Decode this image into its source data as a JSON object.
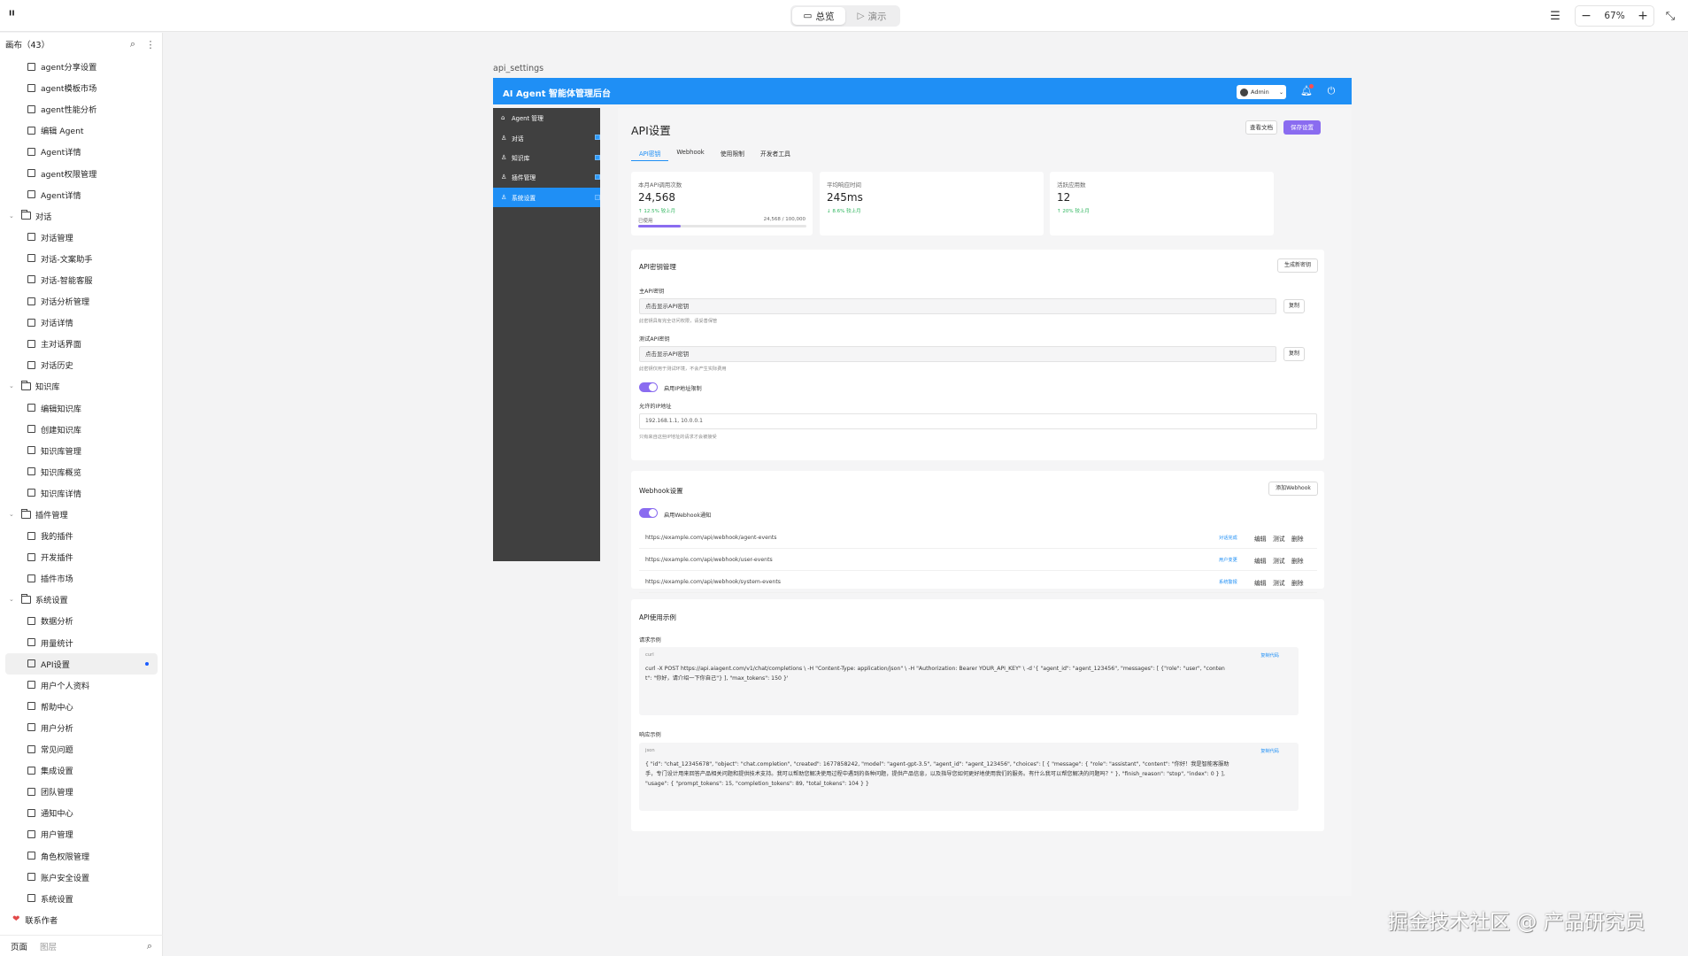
{
  "toolbar": {
    "logo": "ᐦ",
    "overview_label": "总览",
    "present_label": "演示",
    "zoom": "67%",
    "zoom_out": "−",
    "zoom_in": "+"
  },
  "layers_panel": {
    "title": "画布（43）",
    "tree": [
      {
        "type": "page",
        "label": "agent分享设置"
      },
      {
        "type": "page",
        "label": "agent模板市场"
      },
      {
        "type": "page",
        "label": "agent性能分析"
      },
      {
        "type": "page",
        "label": "编辑 Agent"
      },
      {
        "type": "page",
        "label": "Agent详情"
      },
      {
        "type": "page",
        "label": "agent权限管理"
      },
      {
        "type": "page",
        "label": "Agent详情"
      },
      {
        "type": "group",
        "label": "对话"
      },
      {
        "type": "page",
        "label": "对话管理"
      },
      {
        "type": "page",
        "label": "对话-文案助手"
      },
      {
        "type": "page",
        "label": "对话-智能客服"
      },
      {
        "type": "page",
        "label": "对话分析管理"
      },
      {
        "type": "page",
        "label": "对话详情"
      },
      {
        "type": "page",
        "label": "主对话界面"
      },
      {
        "type": "page",
        "label": "对话历史"
      },
      {
        "type": "group",
        "label": "知识库"
      },
      {
        "type": "page",
        "label": "编辑知识库"
      },
      {
        "type": "page",
        "label": "创建知识库"
      },
      {
        "type": "page",
        "label": "知识库管理"
      },
      {
        "type": "page",
        "label": "知识库概览"
      },
      {
        "type": "page",
        "label": "知识库详情"
      },
      {
        "type": "group",
        "label": "插件管理"
      },
      {
        "type": "page",
        "label": "我的插件"
      },
      {
        "type": "page",
        "label": "开发插件"
      },
      {
        "type": "page",
        "label": "插件市场"
      },
      {
        "type": "group",
        "label": "系统设置"
      },
      {
        "type": "page",
        "label": "数据分析"
      },
      {
        "type": "page",
        "label": "用量统计"
      },
      {
        "type": "page",
        "label": "API设置",
        "selected": true
      },
      {
        "type": "page",
        "label": "用户个人资料"
      },
      {
        "type": "page",
        "label": "帮助中心"
      },
      {
        "type": "page",
        "label": "用户分析"
      },
      {
        "type": "page",
        "label": "常见问题"
      },
      {
        "type": "page",
        "label": "集成设置"
      },
      {
        "type": "page",
        "label": "团队管理"
      },
      {
        "type": "page",
        "label": "通知中心"
      },
      {
        "type": "page",
        "label": "用户管理"
      },
      {
        "type": "page",
        "label": "角色权限管理"
      },
      {
        "type": "page",
        "label": "账户安全设置"
      },
      {
        "type": "page",
        "label": "系统设置"
      },
      {
        "type": "contact",
        "label": "联系作者"
      }
    ],
    "footer_tabs": [
      "页面",
      "图层"
    ]
  },
  "frame": {
    "label": "api_settings",
    "header_title": "AI Agent 智能体管理后台",
    "admin_label": "Admin",
    "side_menu": [
      {
        "label": "Agent 管理",
        "icon": "home-icon"
      },
      {
        "label": "对话",
        "icon": "user-icon"
      },
      {
        "label": "知识库",
        "icon": "user-icon"
      },
      {
        "label": "插件管理",
        "icon": "user-icon"
      },
      {
        "label": "系统设置",
        "icon": "user-icon",
        "active": true
      }
    ],
    "page_title": "API设置",
    "btn_docs": "查看文档",
    "btn_save": "保存设置",
    "tabs": [
      "API密钥",
      "Webhook",
      "使用限制",
      "开发者工具"
    ],
    "stats": [
      {
        "label": "本月API调用次数",
        "value": "24,568",
        "trend": "↑ 12.5% 较上月",
        "used_label": "已使用",
        "quota": "24,568 / 100,000",
        "progress": 0.25
      },
      {
        "label": "平均响应时间",
        "value": "245ms",
        "trend": "↓ 8.6% 较上月"
      },
      {
        "label": "活跃应用数",
        "value": "12",
        "trend": "↑ 20% 较上月"
      }
    ],
    "key_section": {
      "title": "API密钥管理",
      "btn_generate": "生成新密钥",
      "main_key_label": "主API密钥",
      "main_key_value": "点击显示API密钥",
      "main_key_hint": "此密钥具有完全访问权限，请妥善保管",
      "test_key_label": "测试API密钥",
      "test_key_value": "点击显示API密钥",
      "test_key_hint": "此密钥仅用于测试环境，不会产生实际费用",
      "copy_label": "复制",
      "ip_toggle_label": "启用IP地址限制",
      "ip_label": "允许的IP地址",
      "ip_value": "192.168.1.1, 10.0.0.1",
      "ip_hint": "只有来自这些IP地址的请求才会被接受"
    },
    "webhook_section": {
      "title": "Webhook设置",
      "btn_add": "添加Webhook",
      "toggle_label": "启用Webhook通知",
      "rows": [
        {
          "url": "https://example.com/api/webhook/agent-events",
          "tag": "对话完成"
        },
        {
          "url": "https://example.com/api/webhook/user-events",
          "tag": "用户变更"
        },
        {
          "url": "https://example.com/api/webhook/system-events",
          "tag": "系统警报"
        }
      ],
      "actions": [
        "编辑",
        "测试",
        "删除"
      ]
    },
    "usage_section": {
      "title": "API使用示例",
      "request_label": "请求示例",
      "request_lang": "curl",
      "request_code": "curl -X POST https://api.aiagent.com/v1/chat/completions \\ -H \"Content-Type: application/json\" \\ -H \"Authorization: Bearer YOUR_API_KEY\" \\ -d '{ \"agent_id\": \"agent_123456\", \"messages\": [ {\"role\": \"user\", \"content\": \"你好，请介绍一下你自己\"} ], \"max_tokens\": 150 }'",
      "response_label": "响应示例",
      "response_lang": "json",
      "response_code": "{ \"id\": \"chat_12345678\", \"object\": \"chat.completion\", \"created\": 1677858242, \"model\": \"agent-gpt-3.5\", \"agent_id\": \"agent_123456\", \"choices\": [ { \"message\": { \"role\": \"assistant\", \"content\": \"你好！我是智能客服助手，专门设计用来回答产品相关问题和提供技术支持。我可以帮助您解决使用过程中遇到的各种问题，提供产品信息，以及指导您如何更好地使用我们的服务。有什么我可以帮您解决的问题吗？\" }, \"finish_reason\": \"stop\", \"index\": 0 } ], \"usage\": { \"prompt_tokens\": 15, \"completion_tokens\": 89, \"total_tokens\": 104 } }",
      "copy_code_label": "复制代码"
    }
  },
  "watermark": "掘金技术社区 @ 产品研究员",
  "colors": {
    "accent": "#1f8ff5",
    "purple": "#8a6cf0",
    "sidebar": "#404040",
    "success": "#2db55d"
  }
}
